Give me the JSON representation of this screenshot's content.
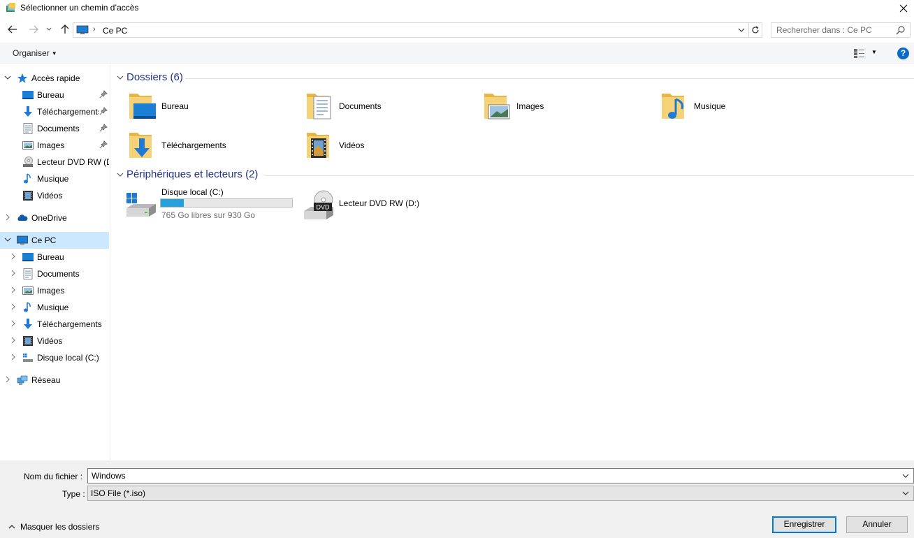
{
  "window": {
    "title": "Sélectionner un chemin d’accès"
  },
  "address": {
    "crumb": "Ce PC",
    "search_placeholder": "Rechercher dans : Ce PC"
  },
  "toolbar": {
    "organize": "Organiser",
    "help": "?"
  },
  "sidebar": {
    "quick_access": {
      "label": "Accès rapide",
      "items": [
        {
          "label": "Bureau",
          "icon": "desktop-icon",
          "pinned": true
        },
        {
          "label": "Téléchargements",
          "icon": "download-icon",
          "pinned": true
        },
        {
          "label": "Documents",
          "icon": "documents-icon",
          "pinned": true
        },
        {
          "label": "Images",
          "icon": "pictures-icon",
          "pinned": true
        },
        {
          "label": "Lecteur DVD RW (D:",
          "icon": "dvd-icon",
          "pinned": false
        },
        {
          "label": "Musique",
          "icon": "music-icon",
          "pinned": false
        },
        {
          "label": "Vidéos",
          "icon": "videos-icon",
          "pinned": false
        }
      ]
    },
    "onedrive": {
      "label": "OneDrive"
    },
    "this_pc": {
      "label": "Ce PC",
      "items": [
        {
          "label": "Bureau",
          "icon": "desktop-icon"
        },
        {
          "label": "Documents",
          "icon": "documents-icon"
        },
        {
          "label": "Images",
          "icon": "pictures-icon"
        },
        {
          "label": "Musique",
          "icon": "music-icon"
        },
        {
          "label": "Téléchargements",
          "icon": "download-icon"
        },
        {
          "label": "Vidéos",
          "icon": "videos-icon"
        },
        {
          "label": "Disque local (C:)",
          "icon": "drive-icon"
        }
      ]
    },
    "network": {
      "label": "Réseau"
    }
  },
  "main": {
    "folders_group": {
      "title": "Dossiers (6)",
      "items": [
        {
          "label": "Bureau",
          "icon": "desktop-folder-icon"
        },
        {
          "label": "Documents",
          "icon": "documents-folder-icon"
        },
        {
          "label": "Images",
          "icon": "pictures-folder-icon"
        },
        {
          "label": "Musique",
          "icon": "music-folder-icon"
        },
        {
          "label": "Téléchargements",
          "icon": "downloads-folder-icon"
        },
        {
          "label": "Vidéos",
          "icon": "videos-folder-icon"
        }
      ]
    },
    "devices_group": {
      "title": "Périphériques et lecteurs (2)",
      "drives": [
        {
          "label": "Disque local (C:)",
          "free": "765 Go libres sur 930 Go",
          "used_fraction": 0.177
        },
        {
          "label": "Lecteur DVD RW (D:)"
        }
      ]
    }
  },
  "bottom": {
    "filename_label": "Nom du fichier :",
    "filename_value": "Windows",
    "type_label": "Type :",
    "type_value": "ISO File (*.iso)",
    "hide_folders": "Masquer les dossiers",
    "save": "Enregistrer",
    "cancel": "Annuler"
  },
  "colors": {
    "accent": "#0078d7",
    "selection": "#cce8ff",
    "group_title": "#1e3287",
    "progress": "#26a0da"
  }
}
